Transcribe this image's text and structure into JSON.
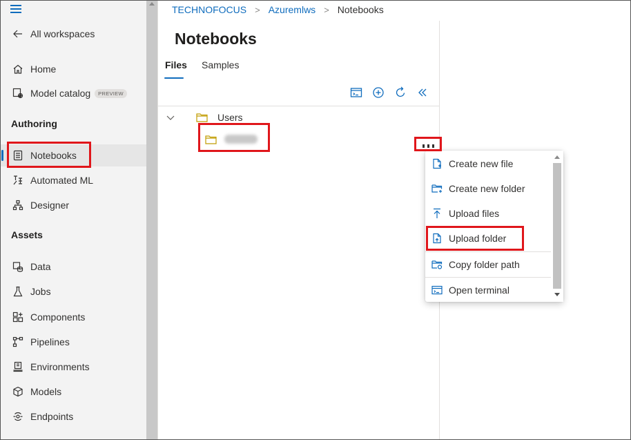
{
  "breadcrumb": {
    "workspace": "TECHNOFOCUS",
    "project": "Azuremlws",
    "current": "Notebooks"
  },
  "sidebar": {
    "back_label": "All workspaces",
    "home": "Home",
    "model_catalog": "Model catalog",
    "preview_badge": "PREVIEW",
    "authoring_heading": "Authoring",
    "notebooks": "Notebooks",
    "automated_ml": "Automated ML",
    "designer": "Designer",
    "assets_heading": "Assets",
    "data": "Data",
    "jobs": "Jobs",
    "components": "Components",
    "pipelines": "Pipelines",
    "environments": "Environments",
    "models": "Models",
    "endpoints": "Endpoints"
  },
  "main": {
    "title": "Notebooks",
    "tabs": {
      "files": "Files",
      "samples": "Samples"
    },
    "tree": {
      "root_folder": "Users"
    }
  },
  "context_menu": {
    "create_new_file": "Create new file",
    "create_new_folder": "Create new folder",
    "upload_files": "Upload files",
    "upload_folder": "Upload folder",
    "copy_folder_path": "Copy folder path",
    "open_terminal": "Open terminal"
  },
  "colors": {
    "accent": "#0f6cbd",
    "highlight": "#e0161b",
    "folder": "#c19c00"
  }
}
